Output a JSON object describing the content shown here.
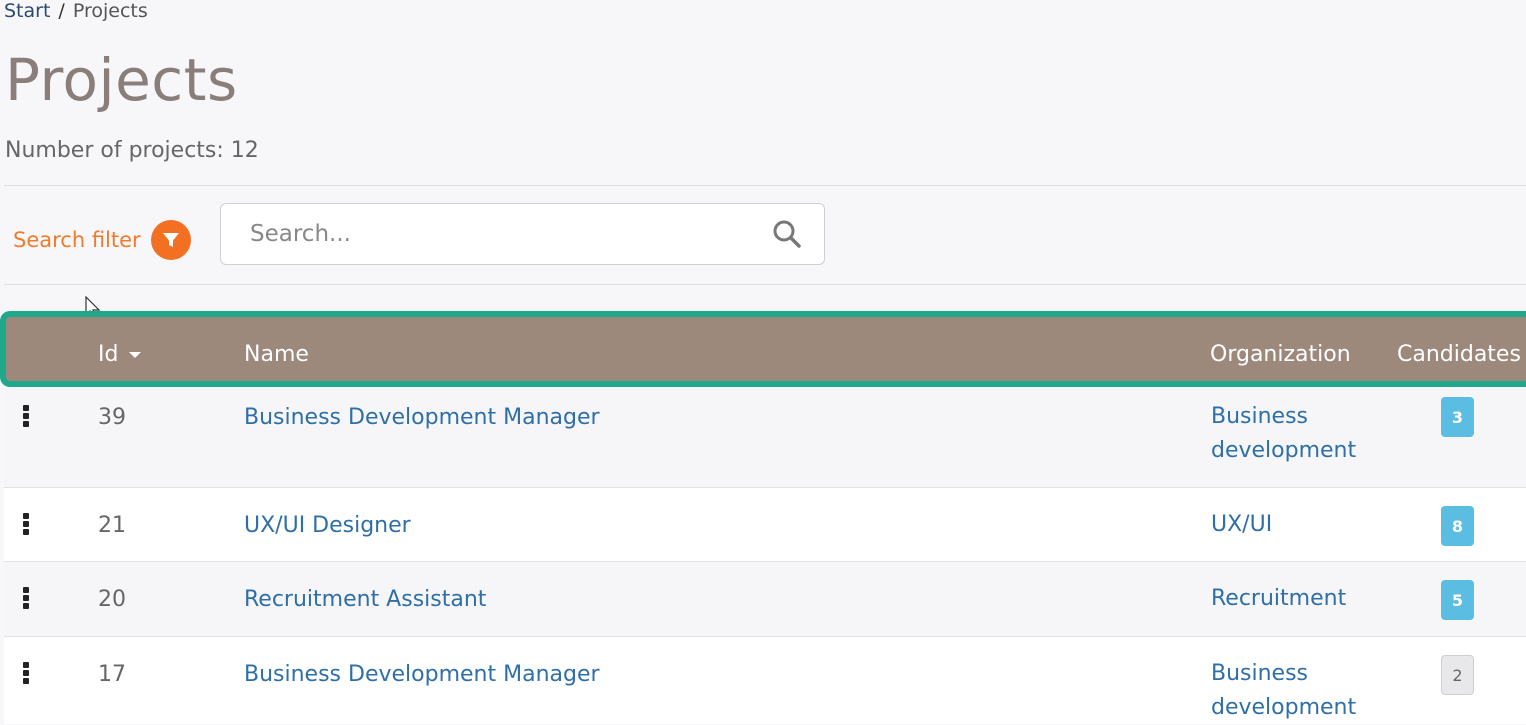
{
  "breadcrumb": {
    "home": "Start",
    "separator": "/",
    "current": "Projects"
  },
  "page": {
    "title": "Projects",
    "count_text": "Number of projects: 12"
  },
  "filter": {
    "label": "Search filter",
    "icon": "funnel-icon",
    "accent": "#f36f21"
  },
  "search": {
    "placeholder": "Search...",
    "value": "",
    "icon": "search-icon"
  },
  "table": {
    "highlight_color": "#1fa88a",
    "header_color": "#9d887c",
    "columns": {
      "id": "Id",
      "name": "Name",
      "organization": "Organization",
      "candidates": "Candidates"
    },
    "sort": {
      "column": "Id",
      "direction": "descending"
    },
    "rows": [
      {
        "id": "39",
        "name": "Business Development Manager",
        "organization": "Business development",
        "candidates": "3",
        "badge": "blue"
      },
      {
        "id": "21",
        "name": "UX/UI Designer",
        "organization": "UX/UI",
        "candidates": "8",
        "badge": "blue"
      },
      {
        "id": "20",
        "name": "Recruitment Assistant",
        "organization": "Recruitment",
        "candidates": "5",
        "badge": "blue"
      },
      {
        "id": "17",
        "name": "Business Development Manager",
        "organization": "Business development",
        "candidates": "2",
        "badge": "gray"
      }
    ]
  }
}
